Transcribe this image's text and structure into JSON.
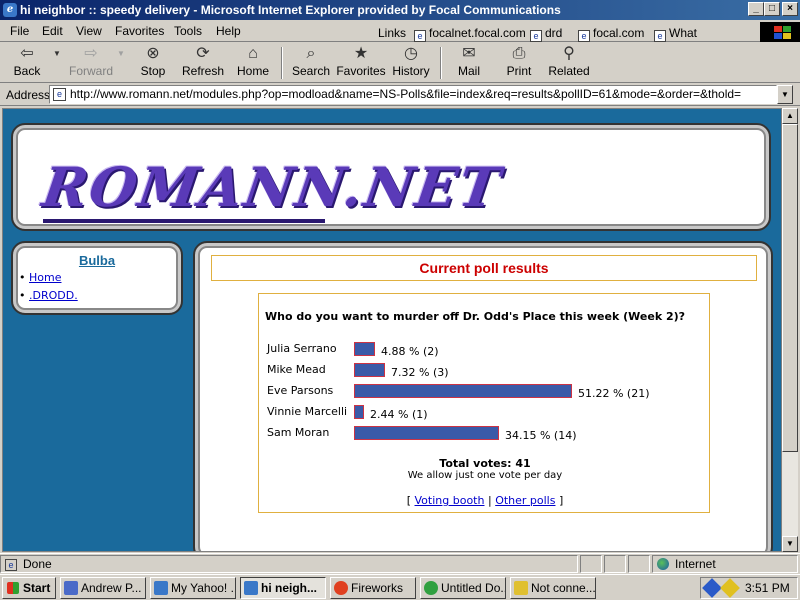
{
  "window": {
    "title": "hi neighbor :: speedy delivery - Microsoft Internet Explorer provided by Focal Communications",
    "min": "_",
    "max": "□",
    "close": "×"
  },
  "menu": [
    "File",
    "Edit",
    "View",
    "Favorites",
    "Tools",
    "Help"
  ],
  "links": {
    "label": "Links",
    "items": [
      "focalnet.focal.com",
      "drd",
      "focal.com",
      "What"
    ]
  },
  "toolbar": {
    "back": "Back",
    "forward": "Forward",
    "stop": "Stop",
    "refresh": "Refresh",
    "home": "Home",
    "search": "Search",
    "favorites": "Favorites",
    "history": "History",
    "mail": "Mail",
    "print": "Print",
    "related": "Related"
  },
  "address": {
    "label": "Address",
    "url": "http://www.romann.net/modules.php?op=modload&name=NS-Polls&file=index&req=results&pollID=61&mode=&order=&thold="
  },
  "site": {
    "logo": "ROMANN.NET"
  },
  "sidebar": {
    "title": "Bulba",
    "items": [
      "Home",
      ".DRODD."
    ]
  },
  "poll": {
    "header": "Current poll results",
    "question": "Who do you want to murder off Dr. Odd's Place this week (Week 2)?",
    "options": [
      {
        "name": "Julia Serrano",
        "percent": 4.88,
        "label": "4.88 % (2)"
      },
      {
        "name": "Mike Mead",
        "percent": 7.32,
        "label": "7.32 % (3)"
      },
      {
        "name": "Eve Parsons",
        "percent": 51.22,
        "label": "51.22 % (21)"
      },
      {
        "name": "Vinnie Marcelli",
        "percent": 2.44,
        "label": "2.44 % (1)"
      },
      {
        "name": "Sam Moran",
        "percent": 34.15,
        "label": "34.15 % (14)"
      }
    ],
    "total": "Total votes: 41",
    "note": "We allow just one vote per day",
    "bracket_open": "[",
    "booth": "Voting booth",
    "divider": "|",
    "other": "Other polls",
    "bracket_close": "]",
    "bar_color": "#3a5aa8"
  },
  "status": {
    "text": "Done",
    "zone": "Internet"
  },
  "taskbar": {
    "start": "Start",
    "tasks": [
      "Andrew P...",
      "My Yahoo! ...",
      "hi neigh...",
      "Fireworks",
      "Untitled Do...",
      "Not conne..."
    ],
    "clock": "3:51 PM"
  },
  "colors": {
    "page_bg": "#1a6a9c",
    "header_text": "#cc0000",
    "link": "#0000cc"
  }
}
